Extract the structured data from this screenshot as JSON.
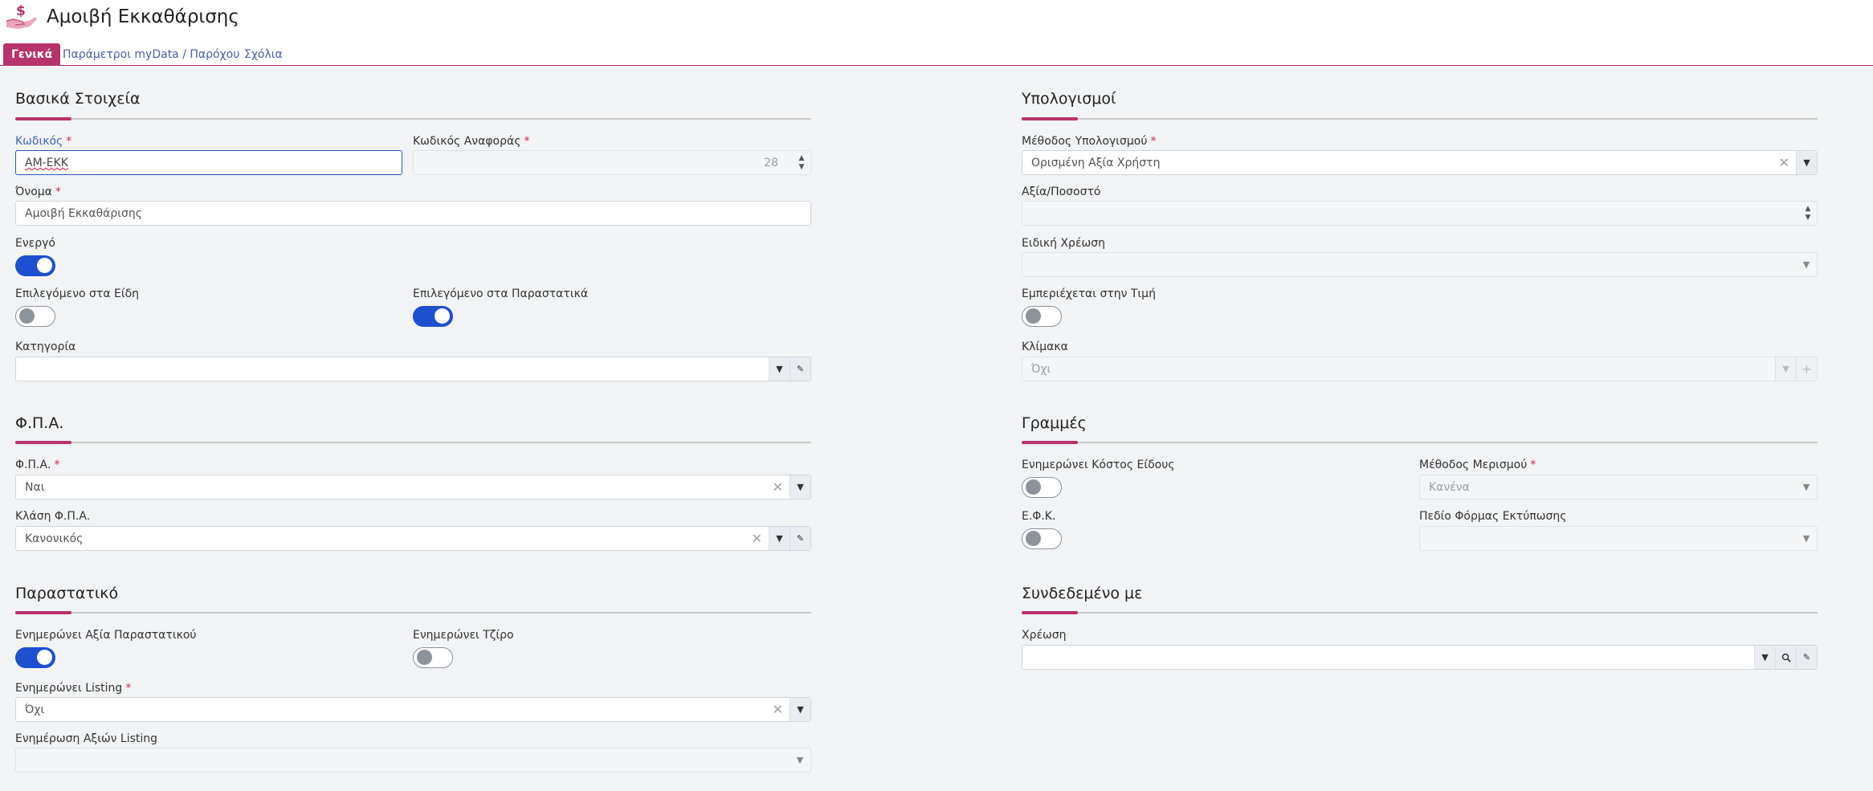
{
  "app": {
    "title": "Αμοιβή Εκκαθάρισης",
    "icon": "hand-dollar-icon"
  },
  "tabs": [
    {
      "label": "Γενικά",
      "active": true
    },
    {
      "label": "Παράμετροι myData / Παρόχου",
      "active": false
    },
    {
      "label": "Σχόλια",
      "active": false
    }
  ],
  "colors": {
    "accent": "#b6336b",
    "toggle_on": "#1f4fd1",
    "focus": "#2b55b8"
  },
  "basic": {
    "title": "Βασικά Στοιχεία",
    "code_label": "Κωδικός",
    "code_value": "ΑΜ-ΕΚΚ",
    "ref_label": "Κωδικός Αναφοράς",
    "ref_value": "28",
    "name_label": "Όνομα",
    "name_value": "Αμοιβή Εκκαθάρισης",
    "active_label": "Ενεργό",
    "active_on": true,
    "items_label": "Επιλεγόμενο στα Είδη",
    "items_on": false,
    "docs_label": "Επιλεγόμενο στα Παραστατικά",
    "docs_on": true,
    "category_label": "Κατηγορία",
    "category_value": ""
  },
  "vat": {
    "title": "Φ.Π.Α.",
    "vat_label": "Φ.Π.Α.",
    "vat_value": "Ναι",
    "class_label": "Κλάση Φ.Π.Α.",
    "class_value": "Κανονικός"
  },
  "doc": {
    "title": "Παραστατικό",
    "update_value_label": "Ενημερώνει Αξία Παραστατικού",
    "update_value_on": true,
    "update_turnover_label": "Ενημερώνει Τζίρο",
    "update_turnover_on": false,
    "listing_label": "Ενημερώνει Listing",
    "listing_value": "Όχι",
    "listing_values_label": "Ενημέρωση Αξιών Listing",
    "listing_values_value": ""
  },
  "calc": {
    "title": "Υπολογισμοί",
    "method_label": "Μέθοδος Υπολογισμού",
    "method_value": "Ορισμένη Αξία Χρήστη",
    "value_label": "Αξία/Ποσοστό",
    "value_value": "",
    "special_label": "Ειδική Χρέωση",
    "special_value": "",
    "included_label": "Εμπεριέχεται στην Τιμή",
    "included_on": false,
    "scale_label": "Κλίμακα",
    "scale_value": "Όχι"
  },
  "lines": {
    "title": "Γραμμές",
    "cost_label": "Ενημερώνει Κόστος Είδους",
    "cost_on": false,
    "split_label": "Μέθοδος Μερισμού",
    "split_value": "Κανένα",
    "efk_label": "Ε.Φ.Κ.",
    "efk_on": false,
    "print_label": "Πεδίο Φόρμας Εκτύπωσης",
    "print_value": ""
  },
  "linked": {
    "title": "Συνδεδεμένο με",
    "charge_label": "Χρέωση",
    "charge_value": ""
  }
}
